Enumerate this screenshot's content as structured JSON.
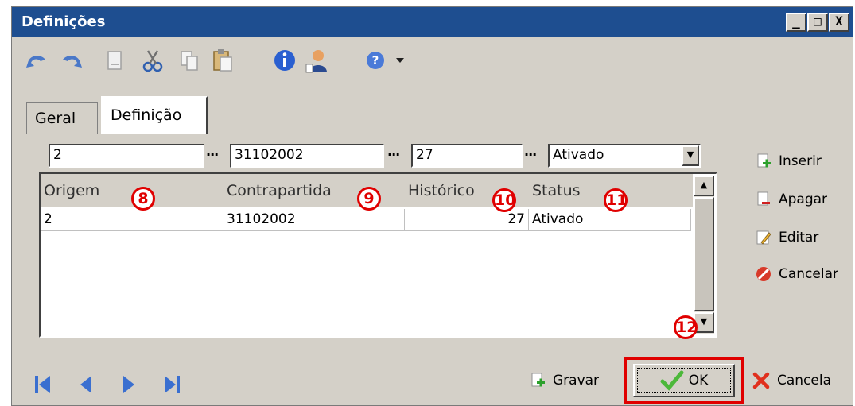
{
  "window": {
    "title": "Definições",
    "controls": [
      "_",
      "□",
      "X"
    ]
  },
  "toolbar": {
    "icons": [
      "undo-icon",
      "redo-icon",
      "new-document-icon",
      "cut-icon",
      "copy-icon",
      "paste-icon",
      "info-icon",
      "user-icon",
      "help-icon",
      "dropdown-arrow-icon"
    ]
  },
  "tabs": [
    {
      "label": "Geral",
      "active": false
    },
    {
      "label": "Definição",
      "active": true
    }
  ],
  "filters": {
    "origem": "2",
    "contrapartida": "31102002",
    "historico": "27",
    "status": "Ativado",
    "ellipsis": "···"
  },
  "grid": {
    "columns": [
      "Origem",
      "Contrapartida",
      "Histórico",
      "Status"
    ],
    "rows": [
      [
        "2",
        "31102002",
        "27",
        "Ativado"
      ]
    ]
  },
  "side_buttons": [
    "Inserir",
    "Apagar",
    "Editar",
    "Cancelar"
  ],
  "badges": [
    "8",
    "9",
    "10",
    "11",
    "12"
  ],
  "bottom": {
    "gravar": "Gravar",
    "ok": "OK",
    "cancela": "Cancela"
  },
  "colors": {
    "titlebar": "#1e4e90",
    "highlight": "#e00000",
    "nav": "#3a6fd0"
  }
}
